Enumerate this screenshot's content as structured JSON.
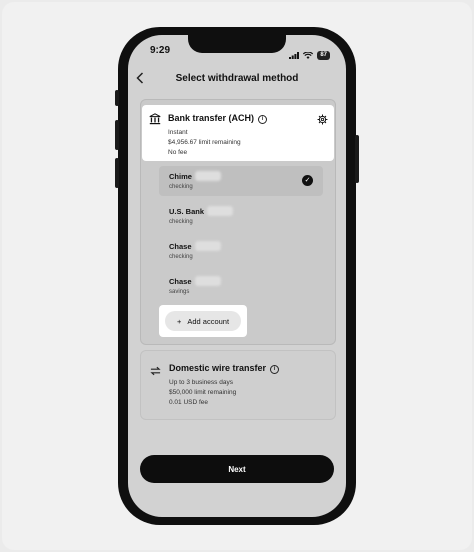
{
  "status": {
    "time": "9:29",
    "battery": "87"
  },
  "header": {
    "title": "Select withdrawal method"
  },
  "ach": {
    "title": "Bank transfer (ACH)",
    "lines": [
      "Instant",
      "$4,956.67 limit remaining",
      "No fee"
    ]
  },
  "accounts": [
    {
      "name": "Chime",
      "type": "checking",
      "selected": true
    },
    {
      "name": "U.S. Bank",
      "type": "checking",
      "selected": false
    },
    {
      "name": "Chase",
      "type": "checking",
      "selected": false
    },
    {
      "name": "Chase",
      "type": "savings",
      "selected": false
    }
  ],
  "add_account": {
    "label": "Add account"
  },
  "wire": {
    "title": "Domestic wire transfer",
    "lines": [
      "Up to 3 business days",
      "$50,000 limit remaining",
      "0.01 USD fee"
    ]
  },
  "footer": {
    "next_label": "Next"
  }
}
